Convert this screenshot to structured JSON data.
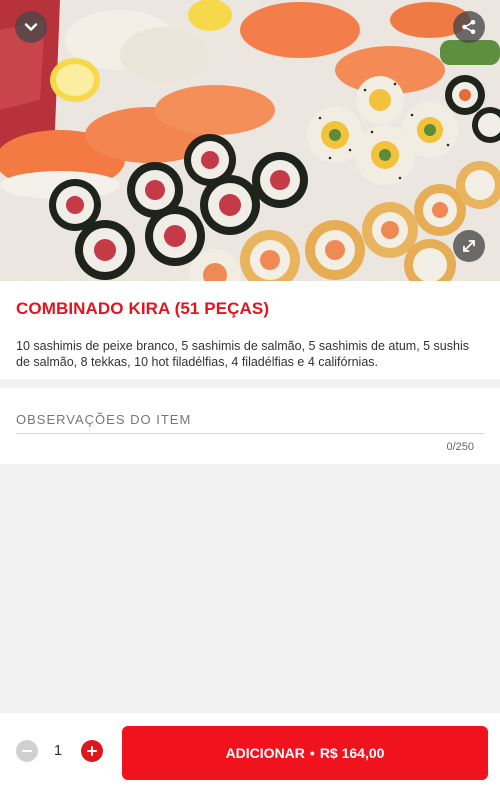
{
  "product": {
    "title": "COMBINADO KIRA (51 PEÇAS)",
    "description": "10 sashimis de peixe branco, 5 sashimis de salmão, 5 sashimis de atum, 5 sushis de salmão, 8 tekkas, 10 hot filadélfias, 4 filadélfias e 4 califórnias.",
    "image_icons": {
      "collapse": "chevron-down-icon",
      "share": "share-icon",
      "expand": "expand-icon"
    }
  },
  "notes": {
    "label": "OBSERVAÇÕES DO ITEM",
    "value": "",
    "counter": "0/250"
  },
  "footer": {
    "quantity": "1",
    "add_label": "ADICIONAR",
    "separator": "•",
    "price": "R$ 164,00"
  },
  "colors": {
    "brand_red": "#e0161d",
    "button_red": "#f0131e"
  }
}
